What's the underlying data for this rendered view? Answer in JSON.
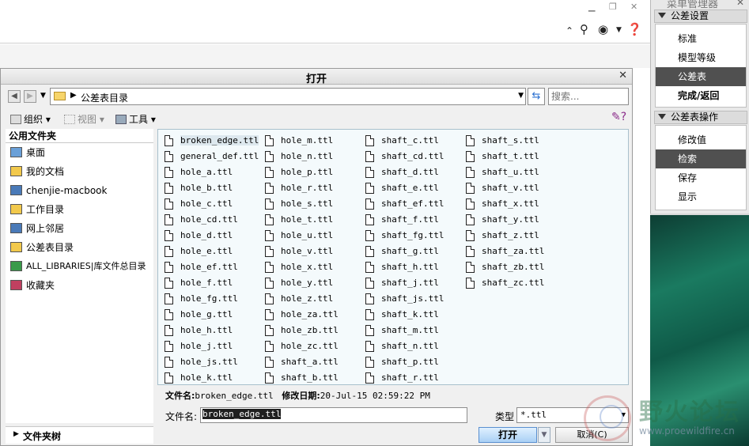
{
  "menu_manager": {
    "title": "菜单管理器",
    "close": "✕",
    "section1": {
      "title": "公差设置",
      "items": [
        {
          "label": "标准",
          "selected": false,
          "bold": false
        },
        {
          "label": "模型等级",
          "selected": false,
          "bold": false
        },
        {
          "label": "公差表",
          "selected": true,
          "bold": false
        },
        {
          "label": "完成/返回",
          "selected": false,
          "bold": true
        }
      ]
    },
    "section2": {
      "title": "公差表操作",
      "items": [
        {
          "label": "修改值",
          "selected": false
        },
        {
          "label": "检索",
          "selected": true
        },
        {
          "label": "保存",
          "selected": false
        },
        {
          "label": "显示",
          "selected": false
        }
      ]
    }
  },
  "dialog": {
    "title": "打开",
    "close": "✕",
    "path": "公差表目录",
    "search_placeholder": "搜索...",
    "toolbar": {
      "organize": "组织",
      "views": "视图",
      "tools": "工具"
    },
    "sidebar": {
      "header": "公用文件夹",
      "items": [
        {
          "label": "桌面",
          "icon": "desktop-icon",
          "color": "#6aa0d8"
        },
        {
          "label": "我的文档",
          "icon": "documents-icon",
          "color": "#f2c94c"
        },
        {
          "label": "chenjie-macbook",
          "icon": "computer-icon",
          "color": "#4a7ab8"
        },
        {
          "label": "工作目录",
          "icon": "work-folder-icon",
          "color": "#f2c94c"
        },
        {
          "label": "网上邻居",
          "icon": "network-icon",
          "color": "#4a7ab8"
        },
        {
          "label": "公差表目录",
          "icon": "folder-icon",
          "color": "#f2c94c"
        },
        {
          "label": "ALL_LIBRARIES|库文件总目录",
          "icon": "library-icon",
          "color": "#3a9a4a"
        },
        {
          "label": "收藏夹",
          "icon": "favorites-icon",
          "color": "#c04060"
        }
      ],
      "folder_tree": "文件夹树"
    },
    "files": {
      "columns": [
        [
          "broken_edge.ttl",
          "general_def.ttl",
          "hole_a.ttl",
          "hole_b.ttl",
          "hole_c.ttl",
          "hole_cd.ttl",
          "hole_d.ttl",
          "hole_e.ttl",
          "hole_ef.ttl",
          "hole_f.ttl",
          "hole_fg.ttl",
          "hole_g.ttl",
          "hole_h.ttl",
          "hole_j.ttl",
          "hole_js.ttl",
          "hole_k.ttl"
        ],
        [
          "hole_m.ttl",
          "hole_n.ttl",
          "hole_p.ttl",
          "hole_r.ttl",
          "hole_s.ttl",
          "hole_t.ttl",
          "hole_u.ttl",
          "hole_v.ttl",
          "hole_x.ttl",
          "hole_y.ttl",
          "hole_z.ttl",
          "hole_za.ttl",
          "hole_zb.ttl",
          "hole_zc.ttl",
          "shaft_a.ttl",
          "shaft_b.ttl"
        ],
        [
          "shaft_c.ttl",
          "shaft_cd.ttl",
          "shaft_d.ttl",
          "shaft_e.ttl",
          "shaft_ef.ttl",
          "shaft_f.ttl",
          "shaft_fg.ttl",
          "shaft_g.ttl",
          "shaft_h.ttl",
          "shaft_j.ttl",
          "shaft_js.ttl",
          "shaft_k.ttl",
          "shaft_m.ttl",
          "shaft_n.ttl",
          "shaft_p.ttl",
          "shaft_r.ttl"
        ],
        [
          "shaft_s.ttl",
          "shaft_t.ttl",
          "shaft_u.ttl",
          "shaft_v.ttl",
          "shaft_x.ttl",
          "shaft_y.ttl",
          "shaft_z.ttl",
          "shaft_za.ttl",
          "shaft_zb.ttl",
          "shaft_zc.ttl"
        ]
      ],
      "selected": "broken_edge.ttl"
    },
    "info": {
      "filename_label": "文件名:",
      "filename_value": "broken_edge.ttl",
      "modified_label": "修改日期:",
      "modified_value": "20-Jul-15 02:59:22 PM"
    },
    "filename_field_label": "文件名:",
    "filename_field_value": "broken_edge.ttl",
    "type_label": "类型",
    "type_value": "*.ttl",
    "open_button": "打开",
    "cancel_button": "取消(C)"
  },
  "watermark": {
    "text": "野火论坛",
    "url": "www.proewildfire.cn"
  }
}
